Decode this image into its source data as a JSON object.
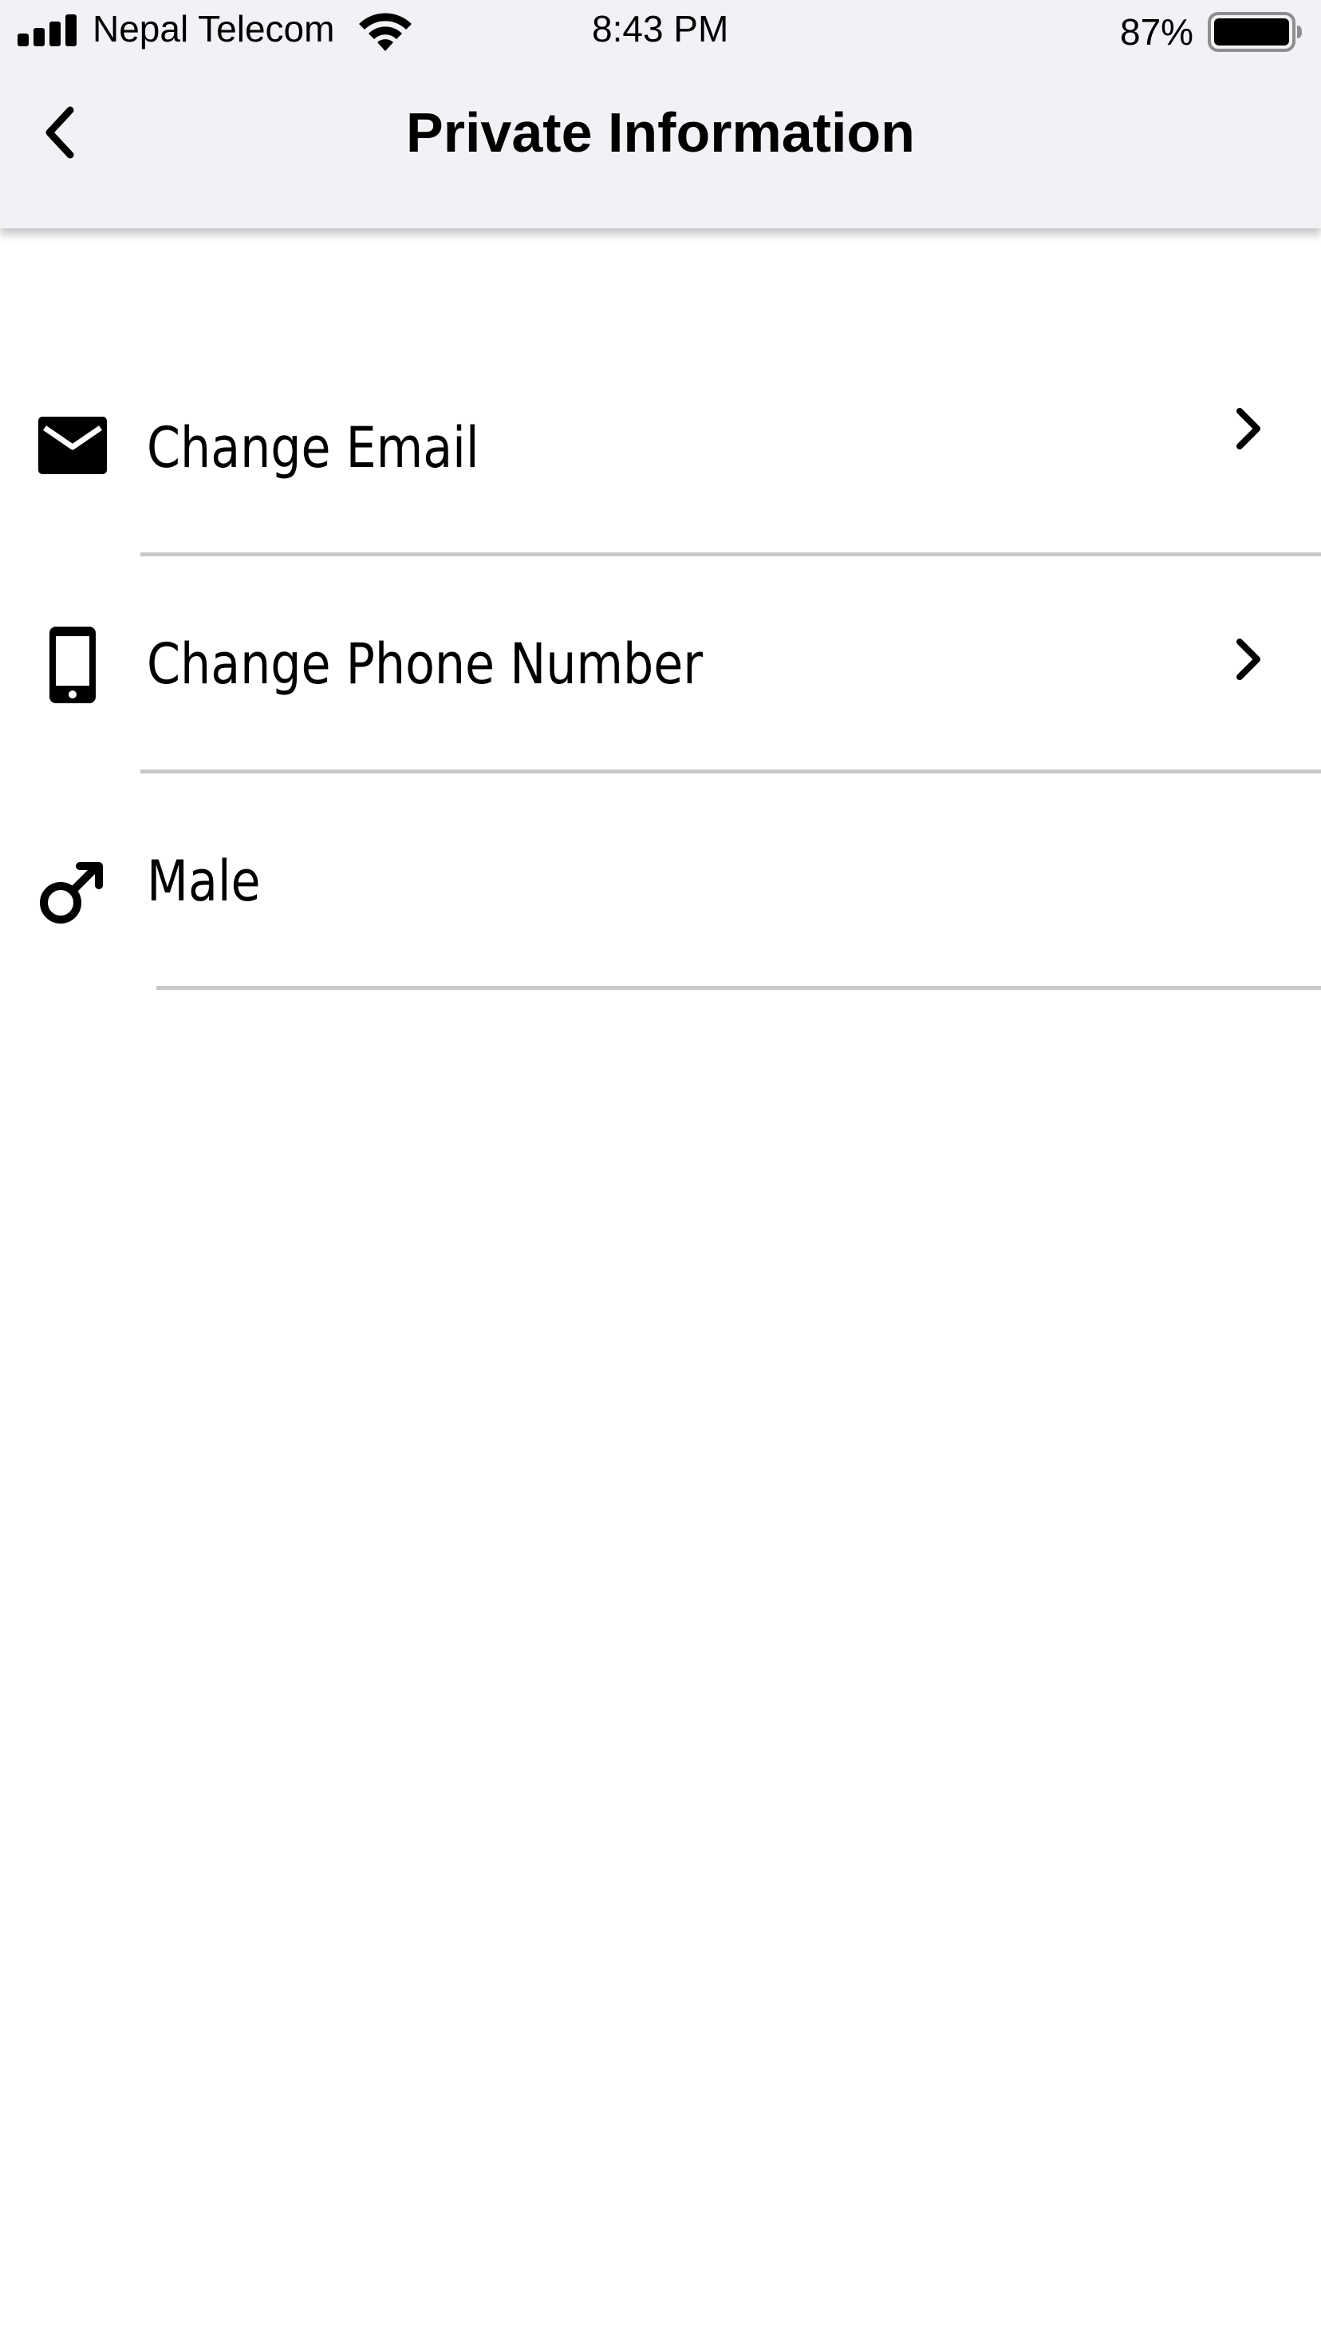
{
  "status_bar": {
    "carrier": "Nepal Telecom",
    "time": "8:43 PM",
    "battery_percent": "87%",
    "battery_level": 0.87,
    "signal_bars": 4,
    "icons": [
      "signal-bars-icon",
      "wifi-icon",
      "battery-icon"
    ]
  },
  "nav": {
    "title": "Private Information",
    "back_icon": "chevron-left-icon"
  },
  "list": {
    "items": [
      {
        "label": "Change Email",
        "icon": "envelope-icon",
        "has_chevron": true
      },
      {
        "label": "Change Phone Number",
        "icon": "phone-icon",
        "has_chevron": true
      },
      {
        "label": "Male",
        "icon": "male-symbol-icon",
        "has_chevron": false
      }
    ]
  },
  "colors": {
    "bar_background": "#f2f1f6",
    "page_background": "#ffffff",
    "divider": "#c8c8c8",
    "text": "#000000"
  }
}
